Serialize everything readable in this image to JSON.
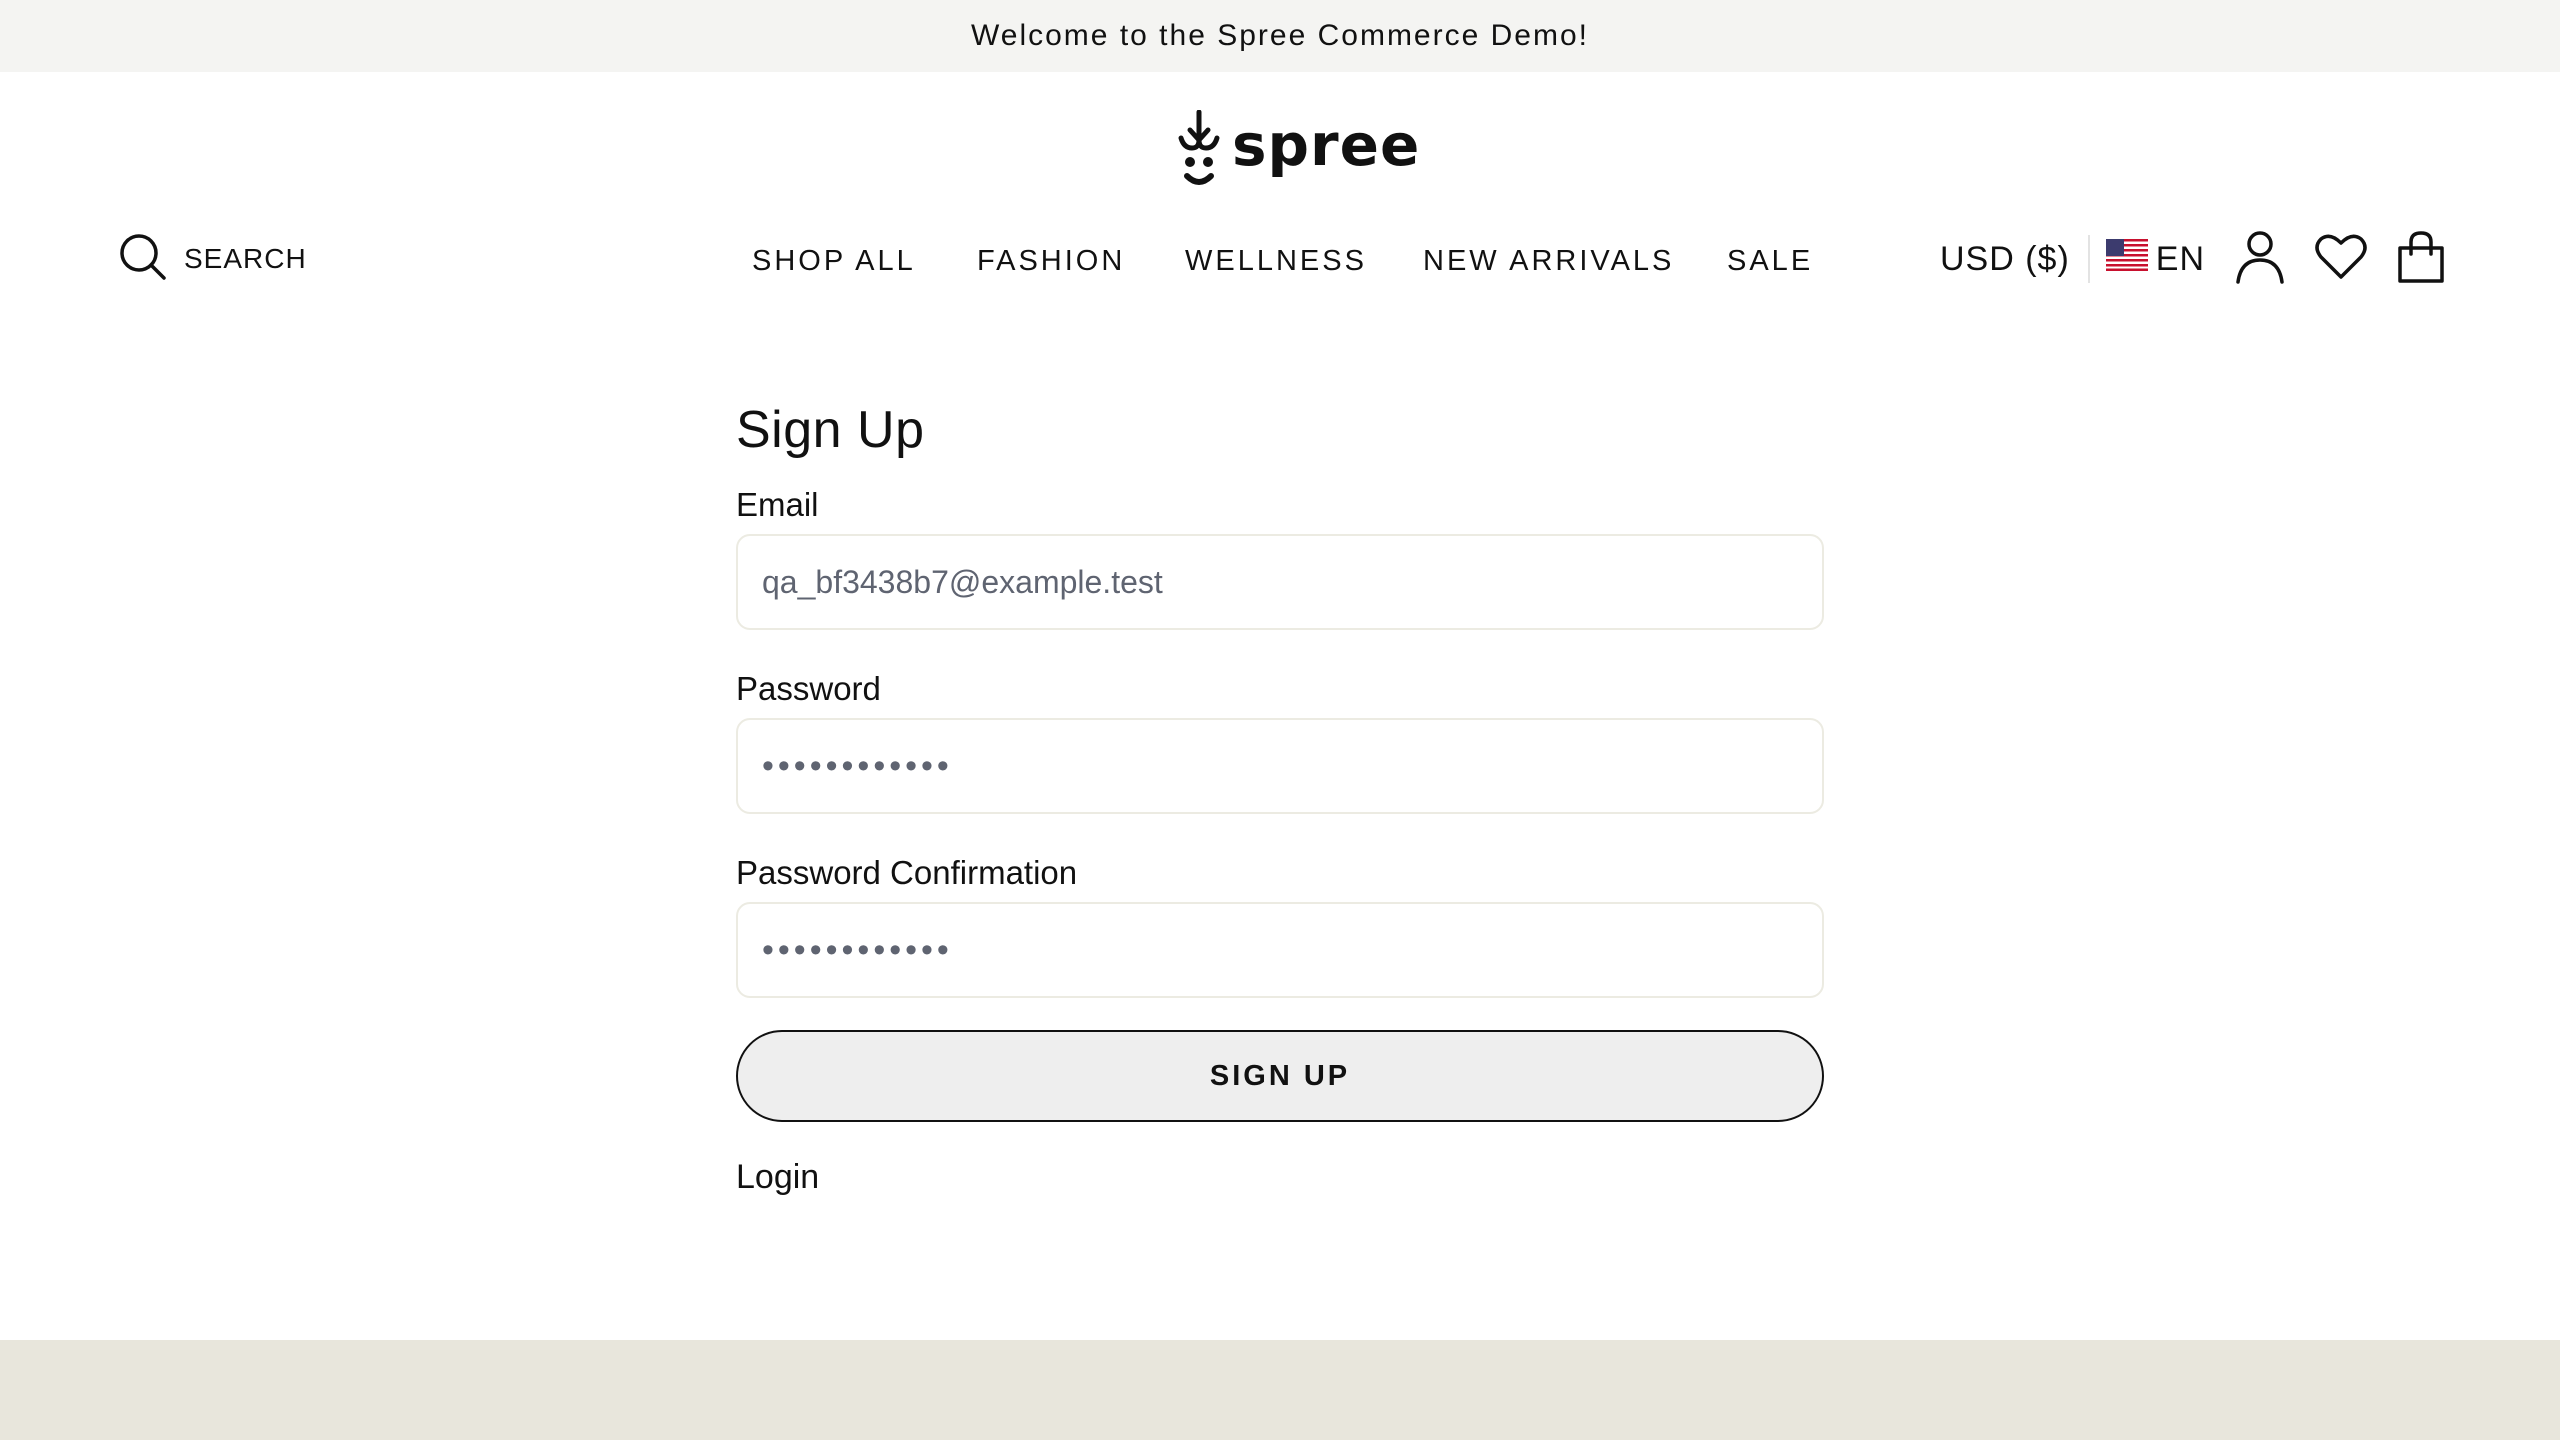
{
  "announcement": "Welcome to the Spree Commerce Demo!",
  "brand": {
    "name": "spree",
    "icon": "spree-logo-icon"
  },
  "search": {
    "label": "SEARCH",
    "icon": "search-icon"
  },
  "nav": {
    "items": [
      {
        "label": "SHOP ALL"
      },
      {
        "label": "FASHION"
      },
      {
        "label": "WELLNESS"
      },
      {
        "label": "NEW ARRIVALS"
      },
      {
        "label": "SALE"
      }
    ]
  },
  "utilities": {
    "currency": "USD ($)",
    "language": "EN",
    "flag_icon": "us-flag-icon",
    "account_icon": "account-icon",
    "wishlist_icon": "heart-icon",
    "cart_icon": "shopping-bag-icon"
  },
  "form": {
    "title": "Sign Up",
    "email": {
      "label": "Email",
      "value": "qa_bf3438b7@example.test"
    },
    "password": {
      "label": "Password",
      "value": "••••••••••••"
    },
    "password_confirmation": {
      "label": "Password Confirmation",
      "value": "••••••••••••"
    },
    "submit_label": "SIGN UP",
    "login_link": "Login"
  },
  "colors": {
    "announcement_bg": "#f4f4f2",
    "footer_bg": "#e8e6dc",
    "button_bg": "#eeeeee",
    "field_border": "#ecebe2",
    "text": "#111111"
  }
}
